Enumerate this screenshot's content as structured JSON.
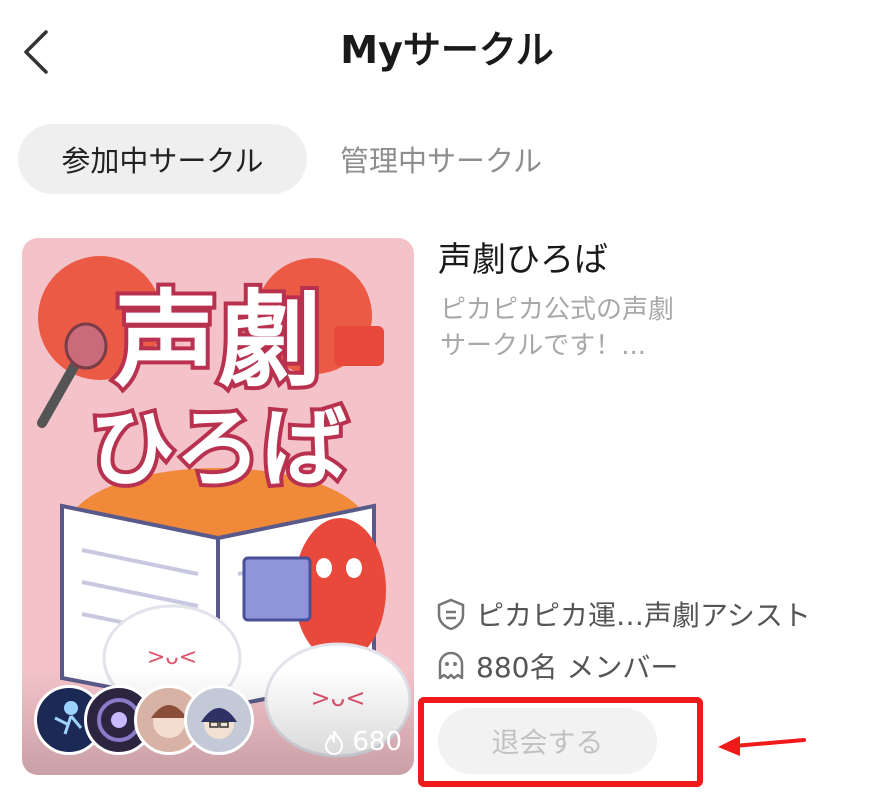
{
  "header": {
    "title": "Myサークル",
    "back_icon": "chevron-left-icon"
  },
  "tabs": [
    {
      "label": "参加中サークル",
      "active": true
    },
    {
      "label": "管理中サークル",
      "active": false
    }
  ],
  "circle": {
    "name": "声劇ひろば",
    "description_line1": "ピカピカ公式の声劇",
    "description_line2": "サークルです！...",
    "cover": {
      "title_line1": "声劇",
      "title_line2": "ひろば",
      "heat": "680",
      "heat_icon": "flame-icon"
    },
    "owner": "ピカピカ運…声劇アシスト",
    "owner_icon": "badge-icon",
    "members": "880名 メンバー",
    "members_icon": "member-face-icon",
    "leave_label": "退会する"
  },
  "annotation": {
    "highlight_color": "#f01a1a",
    "arrow_color": "#f01a1a"
  },
  "colors": {
    "tab_active_bg": "#efefef",
    "cover_bg": "#f6c9cf",
    "mascot_red": "#e8493b"
  }
}
